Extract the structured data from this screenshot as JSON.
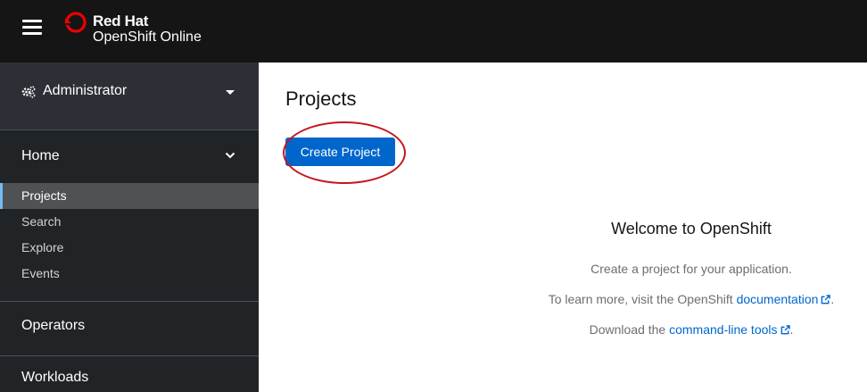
{
  "masthead": {
    "brand": "Red Hat",
    "product": "OpenShift Online",
    "menu_icon": "hamburger-icon",
    "logo_icon": "redhat-logo-icon"
  },
  "sidebar": {
    "perspective": {
      "label": "Administrator",
      "icon": "cogs-icon"
    },
    "sections": [
      {
        "label": "Home",
        "expanded": true,
        "items": [
          {
            "label": "Projects",
            "active": true
          },
          {
            "label": "Search"
          },
          {
            "label": "Explore"
          },
          {
            "label": "Events"
          }
        ]
      },
      {
        "label": "Operators",
        "expanded": false
      },
      {
        "label": "Workloads",
        "expanded": false
      }
    ]
  },
  "main": {
    "title": "Projects",
    "create_button": "Create Project",
    "welcome": {
      "title": "Welcome to OpenShift",
      "line1": "Create a project for your application.",
      "line2_prefix": "To learn more, visit the OpenShift ",
      "line2_link": "documentation",
      "line2_suffix": ".",
      "line3_prefix": "Download the ",
      "line3_link": "command-line tools",
      "line3_suffix": "."
    }
  },
  "colors": {
    "masthead_bg": "#151515",
    "sidebar_bg": "#212427",
    "primary": "#0066cc",
    "active_indicator": "#73bcf7",
    "highlight": "#c4161c"
  }
}
